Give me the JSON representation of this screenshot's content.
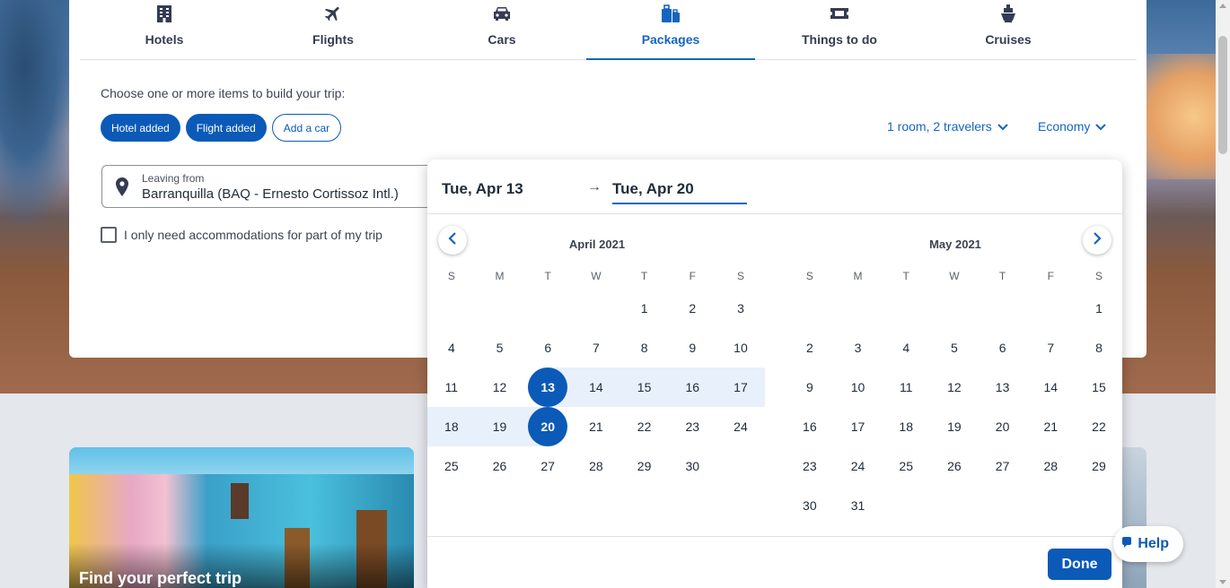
{
  "tabs": [
    {
      "label": "Hotels",
      "icon": "hotel-icon",
      "active": false
    },
    {
      "label": "Flights",
      "icon": "airplane-icon",
      "active": false
    },
    {
      "label": "Cars",
      "icon": "car-icon",
      "active": false
    },
    {
      "label": "Packages",
      "icon": "luggage-icon",
      "active": true
    },
    {
      "label": "Things to do",
      "icon": "ticket-icon",
      "active": false
    },
    {
      "label": "Cruises",
      "icon": "cruise-ship-icon",
      "active": false
    }
  ],
  "builder": {
    "prompt": "Choose one or more items to build your trip:",
    "chips": [
      {
        "label": "Hotel added",
        "selected": true
      },
      {
        "label": "Flight added",
        "selected": true
      },
      {
        "label": "Add a car",
        "selected": false
      }
    ],
    "travelers": "1 room, 2 travelers",
    "cabin": "Economy"
  },
  "leaving": {
    "label": "Leaving from",
    "value": "Barranquilla (BAQ - Ernesto Cortissoz Intl.)"
  },
  "accommodations": {
    "label": "I only need accommodations for part of my trip",
    "checked": false
  },
  "picker": {
    "start_date": "Tue, Apr 13",
    "end_date": "Tue, Apr 20",
    "arrow": "→",
    "weekdays": [
      "S",
      "M",
      "T",
      "W",
      "T",
      "F",
      "S"
    ],
    "months": [
      {
        "title": "April 2021",
        "offset": 4,
        "days": 30,
        "range_start": 13,
        "range_end": 20
      },
      {
        "title": "May 2021",
        "offset": 6,
        "days": 31,
        "range_start": null,
        "range_end": null
      }
    ],
    "done_label": "Done"
  },
  "promo": {
    "caption": "Find your perfect trip"
  },
  "help": {
    "label": "Help"
  },
  "colors": {
    "accent": "#0b5ab8",
    "range": "#e8f0fb"
  }
}
